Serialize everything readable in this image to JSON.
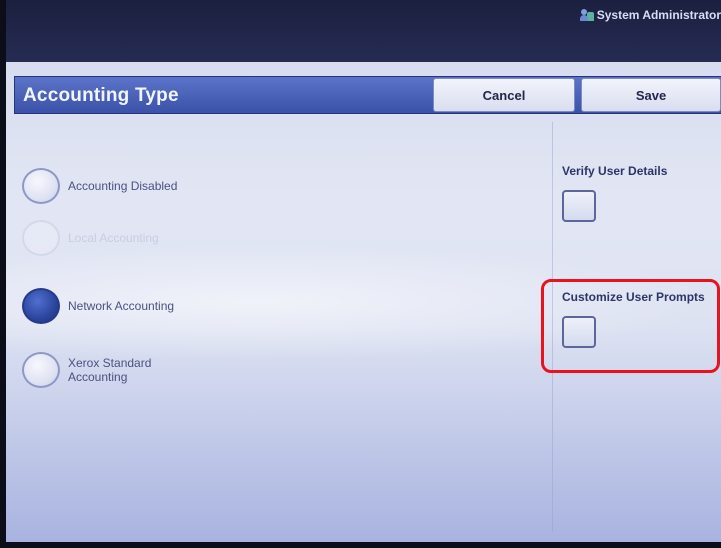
{
  "header": {
    "user_label": "System Administrator",
    "user_icon": "admin-user-icon"
  },
  "title_bar": {
    "title": "Accounting Type",
    "cancel_label": "Cancel",
    "save_label": "Save"
  },
  "accounting_options": [
    {
      "label": "Accounting Disabled",
      "state": "unselected"
    },
    {
      "label": "Local Accounting",
      "state": "disabled"
    },
    {
      "label": "Network Accounting",
      "state": "selected"
    },
    {
      "label": "Xerox Standard Accounting",
      "state": "unselected"
    }
  ],
  "settings": {
    "verify_user_details": {
      "label": "Verify User Details",
      "checked": false
    },
    "customize_user_prompts": {
      "label": "Customize User Prompts",
      "checked": false
    }
  },
  "annotation": {
    "highlight_color": "#e8131c"
  },
  "colors": {
    "title_bar": "#3a53a8",
    "selected_radio": "#2c469e",
    "screen_background": "#dde2f2"
  }
}
